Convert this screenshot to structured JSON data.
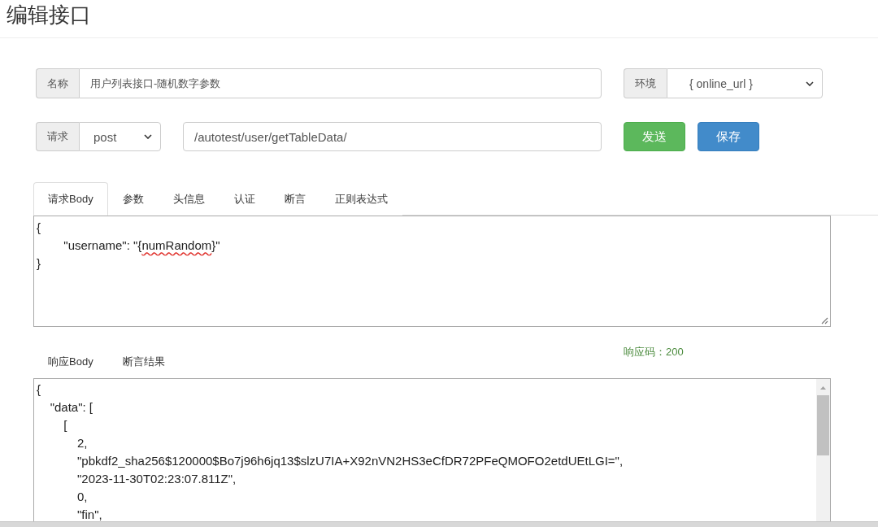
{
  "page": {
    "title": "编辑接口"
  },
  "form": {
    "name": {
      "label": "名称",
      "value": "用户列表接口-随机数字参数"
    },
    "environment": {
      "label": "环境",
      "value": "{ online_url }"
    },
    "request": {
      "label": "请求",
      "method": "post",
      "path": "/autotest/user/getTableData/"
    },
    "buttons": [
      {
        "label": "发送",
        "kind": "success"
      },
      {
        "label": "保存",
        "kind": "primary"
      }
    ]
  },
  "request_tabs": [
    {
      "label": "请求Body",
      "selected": true
    },
    {
      "label": "参数",
      "selected": false
    },
    {
      "label": "头信息",
      "selected": false
    },
    {
      "label": "认证",
      "selected": false
    },
    {
      "label": "断言",
      "selected": false
    },
    {
      "label": "正则表达式",
      "selected": false
    }
  ],
  "request_body": {
    "lines": [
      {
        "segments": [
          {
            "text": "{",
            "misspelled": false
          }
        ]
      },
      {
        "segments": [
          {
            "text": "\t\"username\": \"{",
            "misspelled": false
          },
          {
            "text": "numRandom",
            "misspelled": true
          },
          {
            "text": "}\"",
            "misspelled": false
          }
        ]
      },
      {
        "segments": [
          {
            "text": "}",
            "misspelled": false
          }
        ]
      }
    ]
  },
  "response_tabs": [
    {
      "label": "响应Body",
      "selected": false
    },
    {
      "label": "断言结果",
      "selected": false
    }
  ],
  "response_code": "响应码：200",
  "response_body": {
    "lines": [
      "{",
      "    \"data\": [",
      "        [",
      "            2,",
      "            \"pbkdf2_sha256$120000$Bo7j96h6jq13$slzU7IA+X92nVN2HS3eCfDR72PFeQMOFO2etdUEtLGI=\",",
      "            \"2023-11-30T02:23:07.811Z\",",
      "            0,",
      "            \"fin\","
    ]
  }
}
